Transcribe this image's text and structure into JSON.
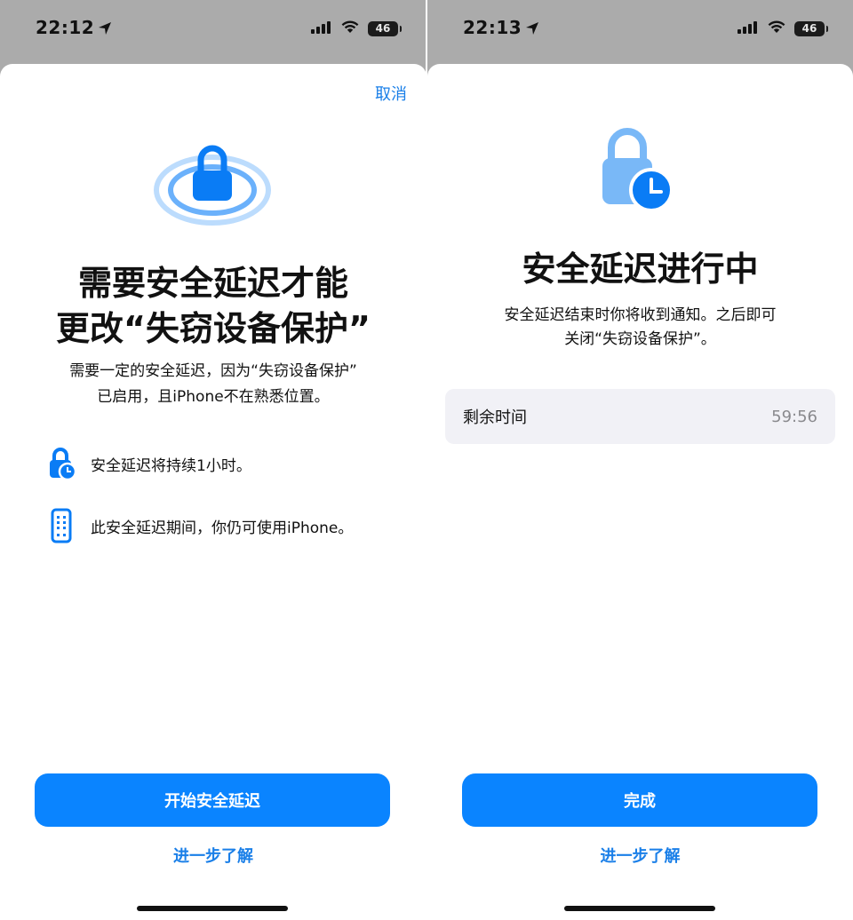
{
  "left": {
    "status": {
      "time": "22:12",
      "battery": "46"
    },
    "cancel_label": "取消",
    "title_line1": "需要安全延迟才能",
    "title_line2": "更改“失窃设备保护”",
    "subtitle_line1": "需要一定的安全延迟，因为“失窃设备保护”",
    "subtitle_line2": "已启用，且iPhone不在熟悉位置。",
    "features": [
      {
        "icon": "lock-clock-icon",
        "text": "安全延迟将持续1小时。"
      },
      {
        "icon": "iphone-icon",
        "text": "此安全延迟期间，你仍可使用iPhone。"
      }
    ],
    "primary_button": "开始安全延迟",
    "learn_more": "进一步了解"
  },
  "right": {
    "status": {
      "time": "22:13",
      "battery": "46"
    },
    "title": "安全延迟进行中",
    "subtitle_line1": "安全延迟结束时你将收到通知。之后即可",
    "subtitle_line2": "关闭“失窃设备保护”。",
    "remaining_label": "剩余时间",
    "remaining_value": "59:56",
    "primary_button": "完成",
    "learn_more": "进一步了解"
  },
  "colors": {
    "accent": "#0a84ff",
    "link": "#1a7fe8",
    "backdrop": "#ababab",
    "row_bg": "#f1f1f6"
  }
}
